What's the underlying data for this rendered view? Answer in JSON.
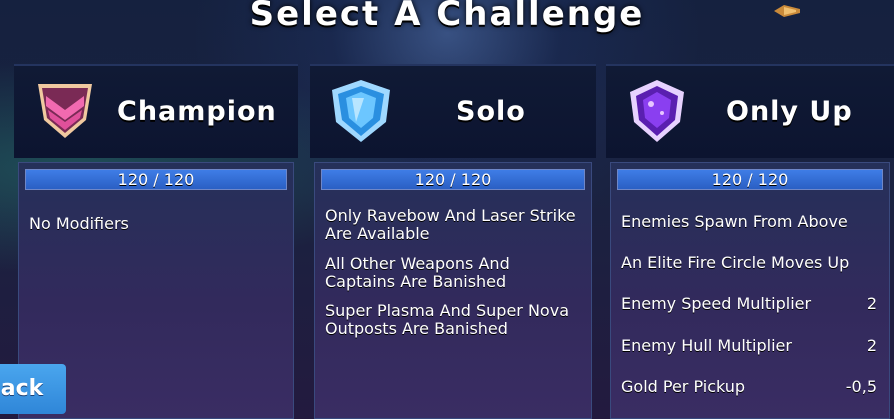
{
  "screen": {
    "title": "Select A Challenge"
  },
  "back_button": {
    "label": "Back"
  },
  "cards": [
    {
      "name": "Champion",
      "emblem": "champion-chevron-icon",
      "progress": {
        "label": "120 / 120",
        "current": 120,
        "max": 120
      },
      "modifiers": [
        {
          "text": "No Modifiers"
        }
      ]
    },
    {
      "name": "Solo",
      "emblem": "solo-shield-icon",
      "progress": {
        "label": "120 / 120",
        "current": 120,
        "max": 120
      },
      "modifiers": [
        {
          "text": "Only Ravebow And Laser Strike Are Available"
        },
        {
          "text": "All Other Weapons And Captains Are Banished"
        },
        {
          "text": "Super Plasma And Super Nova Outposts Are Banished"
        }
      ]
    },
    {
      "name": "Only Up",
      "emblem": "only-up-crystal-icon",
      "progress": {
        "label": "120 / 120",
        "current": 120,
        "max": 120
      },
      "modifiers": [
        {
          "text": "Enemies Spawn From Above",
          "value": ""
        },
        {
          "text": "An Elite Fire Circle Moves Up",
          "value": ""
        },
        {
          "text": "Enemy Speed Multiplier",
          "value": "2"
        },
        {
          "text": "Enemy Hull Multiplier",
          "value": "2"
        },
        {
          "text": "Gold Per Pickup",
          "value": "-0,5"
        }
      ]
    }
  ],
  "colors": {
    "bar_fill": "#3f7de6",
    "back_button": "#3a96e4",
    "panel": "#2a2f5c"
  }
}
